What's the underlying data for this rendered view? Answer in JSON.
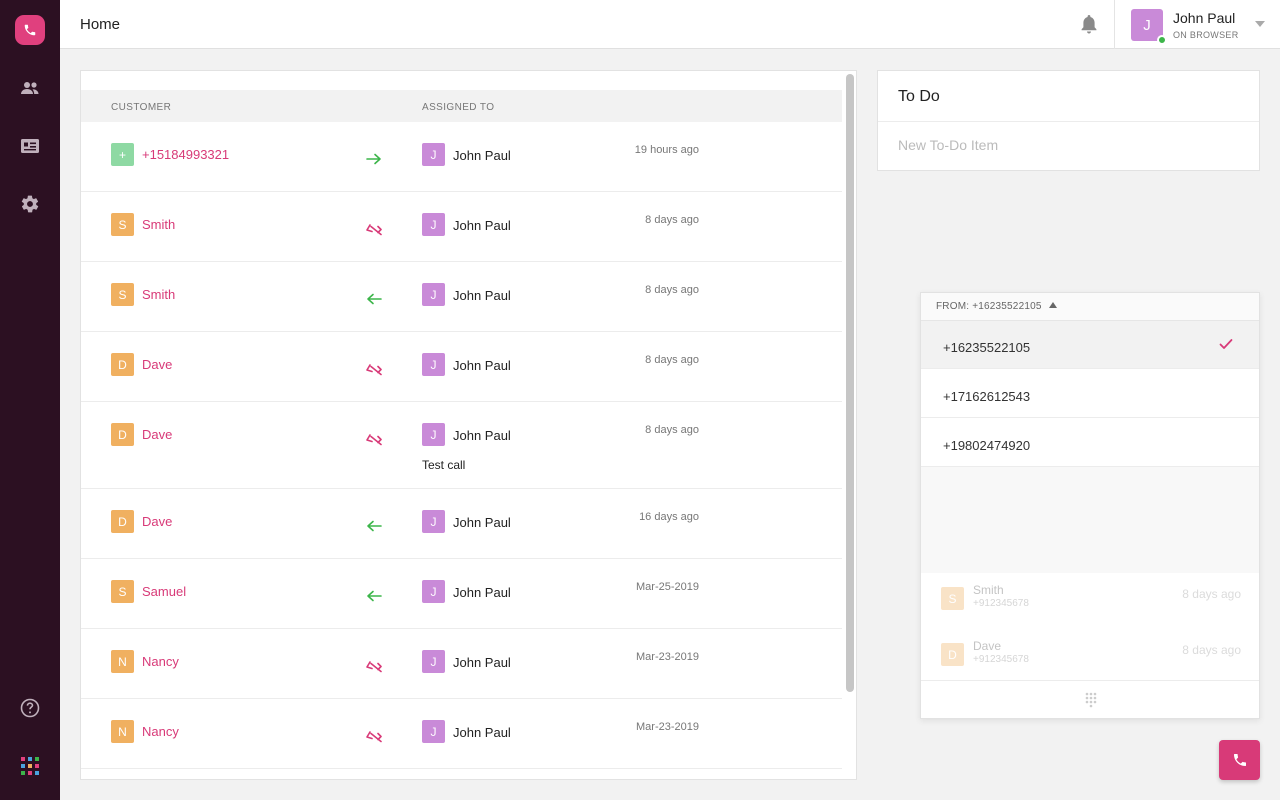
{
  "header": {
    "title": "Home",
    "user": {
      "initial": "J",
      "name": "John Paul",
      "status": "ON BROWSER"
    }
  },
  "calls": {
    "columns": {
      "customer": "CUSTOMER",
      "assigned_to": "ASSIGNED TO"
    },
    "rows": [
      {
        "avatar": "+",
        "avatar_color": "#8ed9a3",
        "name": "+15184993321",
        "direction": "outgoing",
        "agent_initial": "J",
        "agent": "John Paul",
        "time": "19 hours ago",
        "note": ""
      },
      {
        "avatar": "S",
        "avatar_color": "#f0b060",
        "name": "Smith",
        "direction": "missed",
        "agent_initial": "J",
        "agent": "John Paul",
        "time": "8 days ago",
        "note": ""
      },
      {
        "avatar": "S",
        "avatar_color": "#f0b060",
        "name": "Smith",
        "direction": "incoming",
        "agent_initial": "J",
        "agent": "John Paul",
        "time": "8 days ago",
        "note": ""
      },
      {
        "avatar": "D",
        "avatar_color": "#f0b060",
        "name": "Dave",
        "direction": "missed",
        "agent_initial": "J",
        "agent": "John Paul",
        "time": "8 days ago",
        "note": ""
      },
      {
        "avatar": "D",
        "avatar_color": "#f0b060",
        "name": "Dave",
        "direction": "missed",
        "agent_initial": "J",
        "agent": "John Paul",
        "time": "8 days ago",
        "note": "Test call"
      },
      {
        "avatar": "D",
        "avatar_color": "#f0b060",
        "name": "Dave",
        "direction": "incoming",
        "agent_initial": "J",
        "agent": "John Paul",
        "time": "16 days ago",
        "note": ""
      },
      {
        "avatar": "S",
        "avatar_color": "#f0b060",
        "name": "Samuel",
        "direction": "incoming",
        "agent_initial": "J",
        "agent": "John Paul",
        "time": "Mar-25-2019",
        "note": ""
      },
      {
        "avatar": "N",
        "avatar_color": "#f0b060",
        "name": "Nancy",
        "direction": "missed",
        "agent_initial": "J",
        "agent": "John Paul",
        "time": "Mar-23-2019",
        "note": ""
      },
      {
        "avatar": "N",
        "avatar_color": "#f0b060",
        "name": "Nancy",
        "direction": "missed",
        "agent_initial": "J",
        "agent": "John Paul",
        "time": "Mar-23-2019",
        "note": ""
      }
    ]
  },
  "todo": {
    "title": "To Do",
    "placeholder": "New To-Do Item"
  },
  "dialer": {
    "from_label": "FROM: +16235522105",
    "numbers": [
      {
        "number": "+16235522105",
        "selected": true
      },
      {
        "number": "+17162612543",
        "selected": false
      },
      {
        "number": "+19802474920",
        "selected": false
      }
    ],
    "recent": [
      {
        "initial": "S",
        "name": "Smith",
        "number": "+912345678",
        "time": "8 days ago"
      },
      {
        "initial": "D",
        "name": "Dave",
        "number": "+912345678",
        "time": "8 days ago"
      }
    ]
  },
  "icons": {
    "sidebar": [
      "phone-logo-icon",
      "contacts-icon",
      "contact-card-icon",
      "settings-gear-icon",
      "help-icon",
      "apps-grid-icon"
    ],
    "direction": {
      "outgoing": "arrow-right-icon",
      "incoming": "arrow-left-icon",
      "missed": "missed-call-icon"
    }
  },
  "colors": {
    "accent": "#d83a78",
    "sidebar": "#2c1022",
    "incoming": "#3cb54a",
    "agent_avatar": "#c98ad8"
  }
}
